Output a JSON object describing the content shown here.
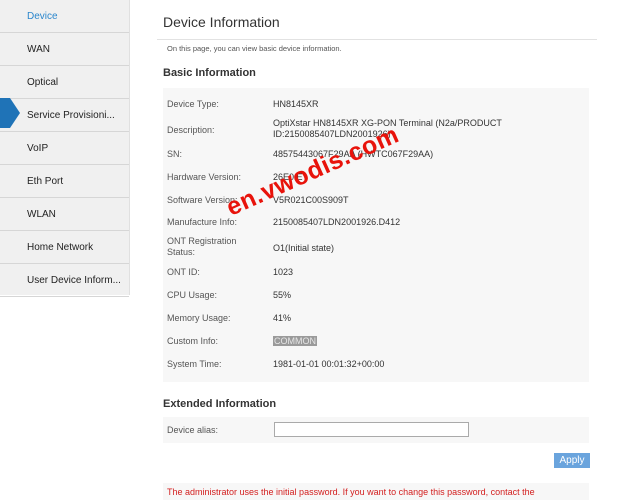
{
  "sidebar": {
    "items": [
      {
        "label": "Device"
      },
      {
        "label": "WAN"
      },
      {
        "label": "Optical"
      },
      {
        "label": "Service Provisioni..."
      },
      {
        "label": "VoIP"
      },
      {
        "label": "Eth Port"
      },
      {
        "label": "WLAN"
      },
      {
        "label": "Home Network"
      },
      {
        "label": "User Device Inform..."
      }
    ]
  },
  "header": {
    "title": "Device Information",
    "description": "On this page, you can view basic device information."
  },
  "basic": {
    "title": "Basic Information",
    "rows": [
      {
        "label": "Device Type:",
        "value": "HN8145XR"
      },
      {
        "label": "Description:",
        "value": "OptiXstar HN8145XR XG-PON Terminal (N2a/PRODUCT ID:2150085407LDN2001926)"
      },
      {
        "label": "SN:",
        "value": "48575443067F29AA (HWTC067F29AA)"
      },
      {
        "label": "Hardware Version:",
        "value": "26E0.E"
      },
      {
        "label": "Software Version:",
        "value": "V5R021C00S909T"
      },
      {
        "label": "Manufacture Info:",
        "value": "2150085407LDN2001926.D412"
      },
      {
        "label": "ONT Registration Status:",
        "value": "O1(Initial state)"
      },
      {
        "label": "ONT ID:",
        "value": "1023"
      },
      {
        "label": "CPU Usage:",
        "value": "55%"
      },
      {
        "label": "Memory Usage:",
        "value": "41%"
      },
      {
        "label": "Custom Info:",
        "value": "COMMON"
      },
      {
        "label": "System Time:",
        "value": "1981-01-01 00:01:32+00:00"
      }
    ]
  },
  "extended": {
    "title": "Extended Information",
    "alias_label": "Device alias:",
    "alias_value": ""
  },
  "apply_label": "Apply",
  "warning": "The administrator uses the initial password. If you want to change this password, contact the",
  "watermark": "en.vwodis.com",
  "colors": {
    "accent": "#1f73b7",
    "apply": "#6aa4dd",
    "warning": "#d32020",
    "watermark": "#e8130b"
  }
}
